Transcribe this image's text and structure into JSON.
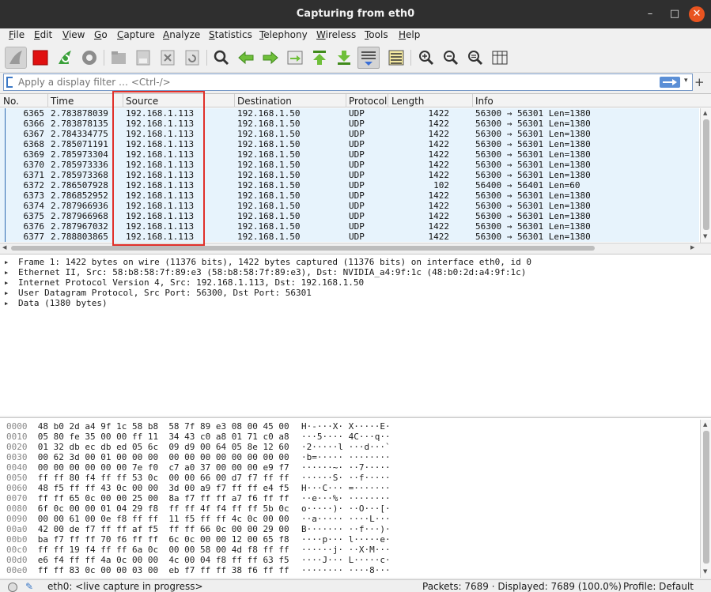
{
  "window": {
    "title": "Capturing from eth0",
    "minimize": "–",
    "maximize": "□",
    "close": "✕"
  },
  "menu": [
    {
      "label": "File"
    },
    {
      "label": "Edit"
    },
    {
      "label": "View"
    },
    {
      "label": "Go"
    },
    {
      "label": "Capture"
    },
    {
      "label": "Analyze"
    },
    {
      "label": "Statistics"
    },
    {
      "label": "Telephony"
    },
    {
      "label": "Wireless"
    },
    {
      "label": "Tools"
    },
    {
      "label": "Help"
    }
  ],
  "toolbar": {
    "icons": [
      "shark-fin-start-icon",
      "stop-capture-icon",
      "restart-capture-icon",
      "capture-options-icon",
      "open-file-icon",
      "save-file-icon",
      "close-file-icon",
      "reload-file-icon",
      "find-packet-icon",
      "go-back-icon",
      "go-forward-icon",
      "go-to-packet-icon",
      "go-first-packet-icon",
      "go-last-packet-icon",
      "auto-scroll-icon",
      "colorize-icon",
      "zoom-in-icon",
      "zoom-out-icon",
      "normal-size-icon",
      "resize-columns-icon"
    ]
  },
  "filter": {
    "placeholder": "Apply a display filter … <Ctrl-/>",
    "add_label": "+"
  },
  "columns": [
    {
      "label": "No."
    },
    {
      "label": "Time"
    },
    {
      "label": "Source"
    },
    {
      "label": "Destination"
    },
    {
      "label": "Protocol"
    },
    {
      "label": "Length"
    },
    {
      "label": "Info"
    }
  ],
  "packets": [
    {
      "no": "6365",
      "time": "2.783878039",
      "source": "192.168.1.113",
      "destination": "192.168.1.50",
      "protocol": "UDP",
      "length": "1422",
      "info": "56300 → 56301 Len=1380"
    },
    {
      "no": "6366",
      "time": "2.783878135",
      "source": "192.168.1.113",
      "destination": "192.168.1.50",
      "protocol": "UDP",
      "length": "1422",
      "info": "56300 → 56301 Len=1380"
    },
    {
      "no": "6367",
      "time": "2.784334775",
      "source": "192.168.1.113",
      "destination": "192.168.1.50",
      "protocol": "UDP",
      "length": "1422",
      "info": "56300 → 56301 Len=1380"
    },
    {
      "no": "6368",
      "time": "2.785071191",
      "source": "192.168.1.113",
      "destination": "192.168.1.50",
      "protocol": "UDP",
      "length": "1422",
      "info": "56300 → 56301 Len=1380"
    },
    {
      "no": "6369",
      "time": "2.785973304",
      "source": "192.168.1.113",
      "destination": "192.168.1.50",
      "protocol": "UDP",
      "length": "1422",
      "info": "56300 → 56301 Len=1380"
    },
    {
      "no": "6370",
      "time": "2.785973336",
      "source": "192.168.1.113",
      "destination": "192.168.1.50",
      "protocol": "UDP",
      "length": "1422",
      "info": "56300 → 56301 Len=1380"
    },
    {
      "no": "6371",
      "time": "2.785973368",
      "source": "192.168.1.113",
      "destination": "192.168.1.50",
      "protocol": "UDP",
      "length": "1422",
      "info": "56300 → 56301 Len=1380"
    },
    {
      "no": "6372",
      "time": "2.786507928",
      "source": "192.168.1.113",
      "destination": "192.168.1.50",
      "protocol": "UDP",
      "length": "102",
      "info": "56400 → 56401 Len=60"
    },
    {
      "no": "6373",
      "time": "2.786852952",
      "source": "192.168.1.113",
      "destination": "192.168.1.50",
      "protocol": "UDP",
      "length": "1422",
      "info": "56300 → 56301 Len=1380"
    },
    {
      "no": "6374",
      "time": "2.787966936",
      "source": "192.168.1.113",
      "destination": "192.168.1.50",
      "protocol": "UDP",
      "length": "1422",
      "info": "56300 → 56301 Len=1380"
    },
    {
      "no": "6375",
      "time": "2.787966968",
      "source": "192.168.1.113",
      "destination": "192.168.1.50",
      "protocol": "UDP",
      "length": "1422",
      "info": "56300 → 56301 Len=1380"
    },
    {
      "no": "6376",
      "time": "2.787967032",
      "source": "192.168.1.113",
      "destination": "192.168.1.50",
      "protocol": "UDP",
      "length": "1422",
      "info": "56300 → 56301 Len=1380"
    },
    {
      "no": "6377",
      "time": "2.788803865",
      "source": "192.168.1.113",
      "destination": "192.168.1.50",
      "protocol": "UDP",
      "length": "1422",
      "info": "56300 → 56301 Len=1380"
    }
  ],
  "details": [
    "Frame 1: 1422 bytes on wire (11376 bits), 1422 bytes captured (11376 bits) on interface eth0, id 0",
    "Ethernet II, Src: 58:b8:58:7f:89:e3 (58:b8:58:7f:89:e3), Dst: NVIDIA_a4:9f:1c (48:b0:2d:a4:9f:1c)",
    "Internet Protocol Version 4, Src: 192.168.1.113, Dst: 192.168.1.50",
    "User Datagram Protocol, Src Port: 56300, Dst Port: 56301",
    "Data (1380 bytes)"
  ],
  "bytes": [
    {
      "offset": "0000",
      "hex": "48 b0 2d a4 9f 1c 58 b8  58 7f 89 e3 08 00 45 00",
      "ascii": "H·-···X· X·····E·"
    },
    {
      "offset": "0010",
      "hex": "05 80 fe 35 00 00 ff 11  34 43 c0 a8 01 71 c0 a8",
      "ascii": "···5···· 4C···q··"
    },
    {
      "offset": "0020",
      "hex": "01 32 db ec db ed 05 6c  09 d9 00 64 05 8e 12 60",
      "ascii": "·2·····l ···d···`"
    },
    {
      "offset": "0030",
      "hex": "00 62 3d 00 01 00 00 00  00 00 00 00 00 00 00 00",
      "ascii": "·b=····· ········"
    },
    {
      "offset": "0040",
      "hex": "00 00 00 00 00 00 7e f0  c7 a0 37 00 00 00 e9 f7",
      "ascii": "······~· ··7·····"
    },
    {
      "offset": "0050",
      "hex": "ff ff 80 f4 ff ff 53 0c  00 00 66 00 d7 f7 ff ff",
      "ascii": "······S· ··f·····"
    },
    {
      "offset": "0060",
      "hex": "48 f5 ff ff 43 0c 00 00  3d 00 a9 f7 ff ff e4 f5",
      "ascii": "H···C··· =·······"
    },
    {
      "offset": "0070",
      "hex": "ff ff 65 0c 00 00 25 00  8a f7 ff ff a7 f6 ff ff",
      "ascii": "··e···%· ········"
    },
    {
      "offset": "0080",
      "hex": "6f 0c 00 00 01 04 29 f8  ff ff 4f f4 ff ff 5b 0c",
      "ascii": "o·····)· ··O···[·"
    },
    {
      "offset": "0090",
      "hex": "00 00 61 00 0e f8 ff ff  11 f5 ff ff 4c 0c 00 00",
      "ascii": "··a····· ····L···"
    },
    {
      "offset": "00a0",
      "hex": "42 00 de f7 ff ff af f5  ff ff 66 0c 00 00 29 00",
      "ascii": "B······· ··f···)·"
    },
    {
      "offset": "00b0",
      "hex": "ba f7 ff ff 70 f6 ff ff  6c 0c 00 00 12 00 65 f8",
      "ascii": "····p··· l·····e·"
    },
    {
      "offset": "00c0",
      "hex": "ff ff 19 f4 ff ff 6a 0c  00 00 58 00 4d f8 ff ff",
      "ascii": "······j· ··X·M···"
    },
    {
      "offset": "00d0",
      "hex": "e6 f4 ff ff 4a 0c 00 00  4c 00 04 f8 ff ff 63 f5",
      "ascii": "····J··· L·····c·"
    },
    {
      "offset": "00e0",
      "hex": "ff ff 83 0c 00 00 03 00  eb f7 ff ff 38 f6 ff ff",
      "ascii": "········ ····8···"
    }
  ],
  "status": {
    "interface": "eth0: <live capture in progress>",
    "packets": "Packets: 7689 · Displayed: 7689 (100.0%)",
    "profile": "Profile: Default"
  },
  "colors": {
    "accent": "#e95420",
    "row_bg": "#e7f3fc",
    "highlight_box": "#e0302a"
  }
}
